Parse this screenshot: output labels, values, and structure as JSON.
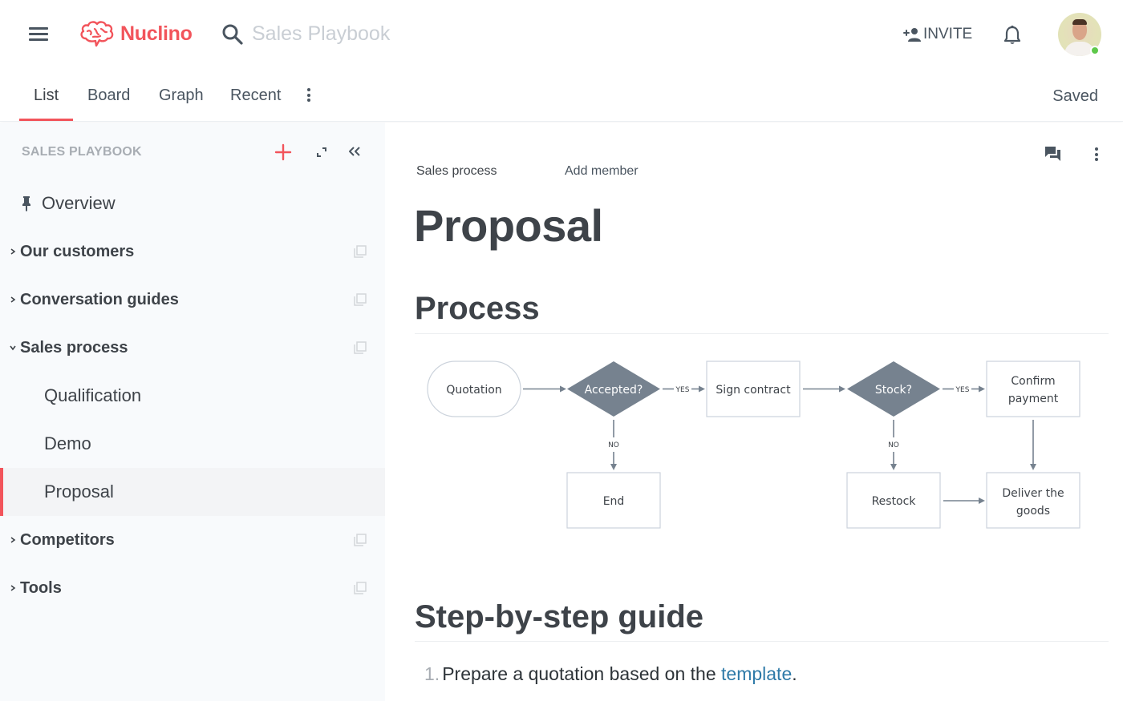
{
  "app": {
    "brand": "Nuclino",
    "brand_color": "#f2545b",
    "search_placeholder": "Sales Playbook",
    "invite_label": "INVITE",
    "status_online_color": "#5ec84a"
  },
  "tabs": {
    "items": [
      {
        "label": "List",
        "active": true
      },
      {
        "label": "Board",
        "active": false
      },
      {
        "label": "Graph",
        "active": false
      },
      {
        "label": "Recent",
        "active": false
      }
    ],
    "save_status": "Saved"
  },
  "sidebar": {
    "title": "SALES PLAYBOOK",
    "items": [
      {
        "label": "Overview",
        "icon": "pin-icon",
        "type": "pinned"
      },
      {
        "label": "Our customers",
        "type": "collection",
        "expanded": false
      },
      {
        "label": "Conversation guides",
        "type": "collection",
        "expanded": false
      },
      {
        "label": "Sales process",
        "type": "collection",
        "expanded": true
      },
      {
        "label": "Qualification",
        "type": "child"
      },
      {
        "label": "Demo",
        "type": "child"
      },
      {
        "label": "Proposal",
        "type": "child",
        "selected": true
      },
      {
        "label": "Competitors",
        "type": "collection",
        "expanded": false
      },
      {
        "label": "Tools",
        "type": "collection",
        "expanded": false
      }
    ]
  },
  "document": {
    "breadcrumb": "Sales process",
    "add_member": "Add member",
    "title": "Proposal",
    "section1": "Process",
    "section2": "Step-by-step guide",
    "steps": [
      {
        "num": "1.",
        "text_before": "Prepare a quotation based on the ",
        "link": "template",
        "text_after": "."
      }
    ]
  },
  "flowchart": {
    "nodes": {
      "quotation": "Quotation",
      "accepted": "Accepted?",
      "sign": "Sign contract",
      "stock": "Stock?",
      "confirm1": "Confirm",
      "confirm2": "payment",
      "end": "End",
      "restock": "Restock",
      "deliver1": "Deliver the",
      "deliver2": "goods"
    },
    "labels": {
      "yes": "YES",
      "no": "NO"
    },
    "decision_color": "#76828f",
    "line_color": "#76828f"
  }
}
